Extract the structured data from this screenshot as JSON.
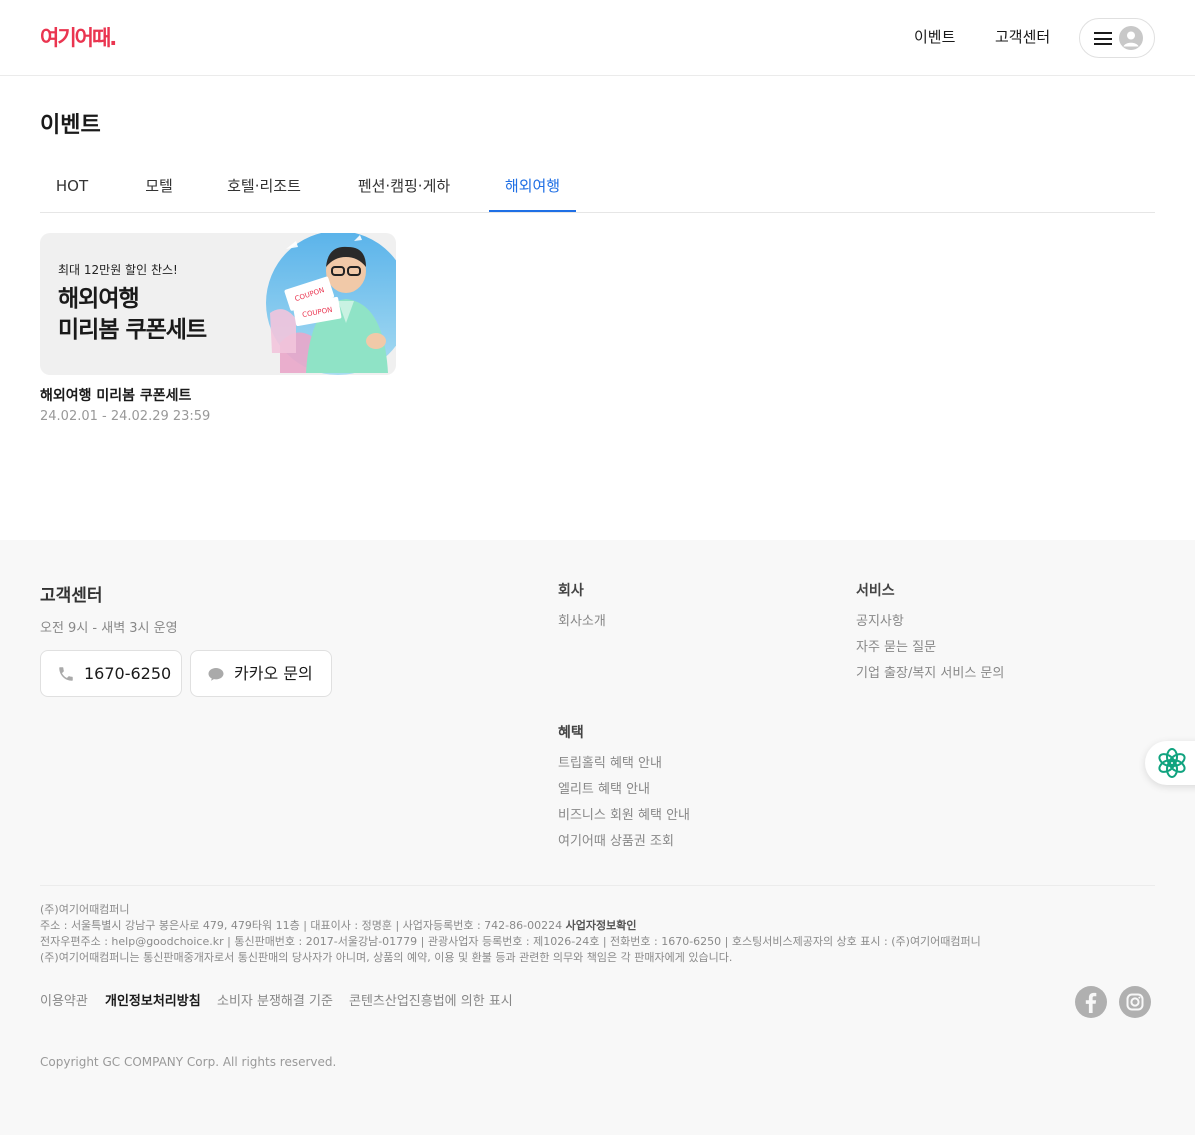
{
  "header": {
    "logo": "여기어때.",
    "nav": {
      "event": "이벤트",
      "customer_center": "고객센터"
    }
  },
  "page": {
    "title": "이벤트",
    "tabs": [
      {
        "label": "HOT"
      },
      {
        "label": "모텔"
      },
      {
        "label": "호텔·리조트"
      },
      {
        "label": "펜션·캠핑·게하"
      },
      {
        "label": "해외여행",
        "active": true
      }
    ]
  },
  "events": [
    {
      "banner_sub": "최대 12만원 할인 찬스!",
      "banner_line1": "해외여행",
      "banner_line2": "미리봄 쿠폰세트",
      "coupon_text": "COUPON",
      "title": "해외여행 미리봄 쿠폰세트",
      "period": "24.02.01 - 24.02.29 23:59"
    }
  ],
  "footer": {
    "cs": {
      "title": "고객센터",
      "hours": "오전 9시 - 새벽 3시 운영",
      "phone": "1670-6250",
      "kakao": "카카오 문의"
    },
    "company": {
      "title": "회사",
      "links": [
        "회사소개"
      ]
    },
    "service": {
      "title": "서비스",
      "links": [
        "공지사항",
        "자주 묻는 질문",
        "기업 출장/복지 서비스 문의"
      ]
    },
    "benefit": {
      "title": "혜택",
      "links": [
        "트립홀릭 혜택 안내",
        "엘리트 혜택 안내",
        "비즈니스 회원 혜택 안내",
        "여기어때 상품권 조회"
      ]
    },
    "info": {
      "line1": "(주)여기어때컴퍼니",
      "line2": "주소 : 서울특별시 강남구 봉은사로 479, 479타워 11층 | 대표이사 : 정명훈 | 사업자등록번호 : 742-86-00224",
      "line2_link": "사업자정보확인",
      "line3": "전자우편주소 : help@goodchoice.kr | 통신판매번호 : 2017-서울강남-01779 | 관광사업자 등록번호 : 제1026-24호 | 전화번호 : 1670-6250 | 호스팅서비스제공자의 상호 표시 : (주)여기어때컴퍼니",
      "line4": "(주)여기어때컴퍼니는 통신판매중개자로서 통신판매의 당사자가 아니며, 상품의 예약, 이용 및 환불 등과 관련한 의무와 책임은 각 판매자에게 있습니다."
    },
    "policies": [
      "이용약관",
      "개인정보처리방침",
      "소비자 분쟁해결 기준",
      "콘텐츠산업진흥법에 의한 표시"
    ],
    "copyright": "Copyright GC COMPANY Corp. All rights reserved."
  },
  "colors": {
    "brand": "#ea3550",
    "active_tab": "#1f6fe5",
    "float_icon": "#10a37f"
  },
  "icons": [
    "hamburger-icon",
    "user-icon",
    "phone-icon",
    "chat-icon",
    "facebook-icon",
    "instagram-icon",
    "assistant-icon"
  ]
}
